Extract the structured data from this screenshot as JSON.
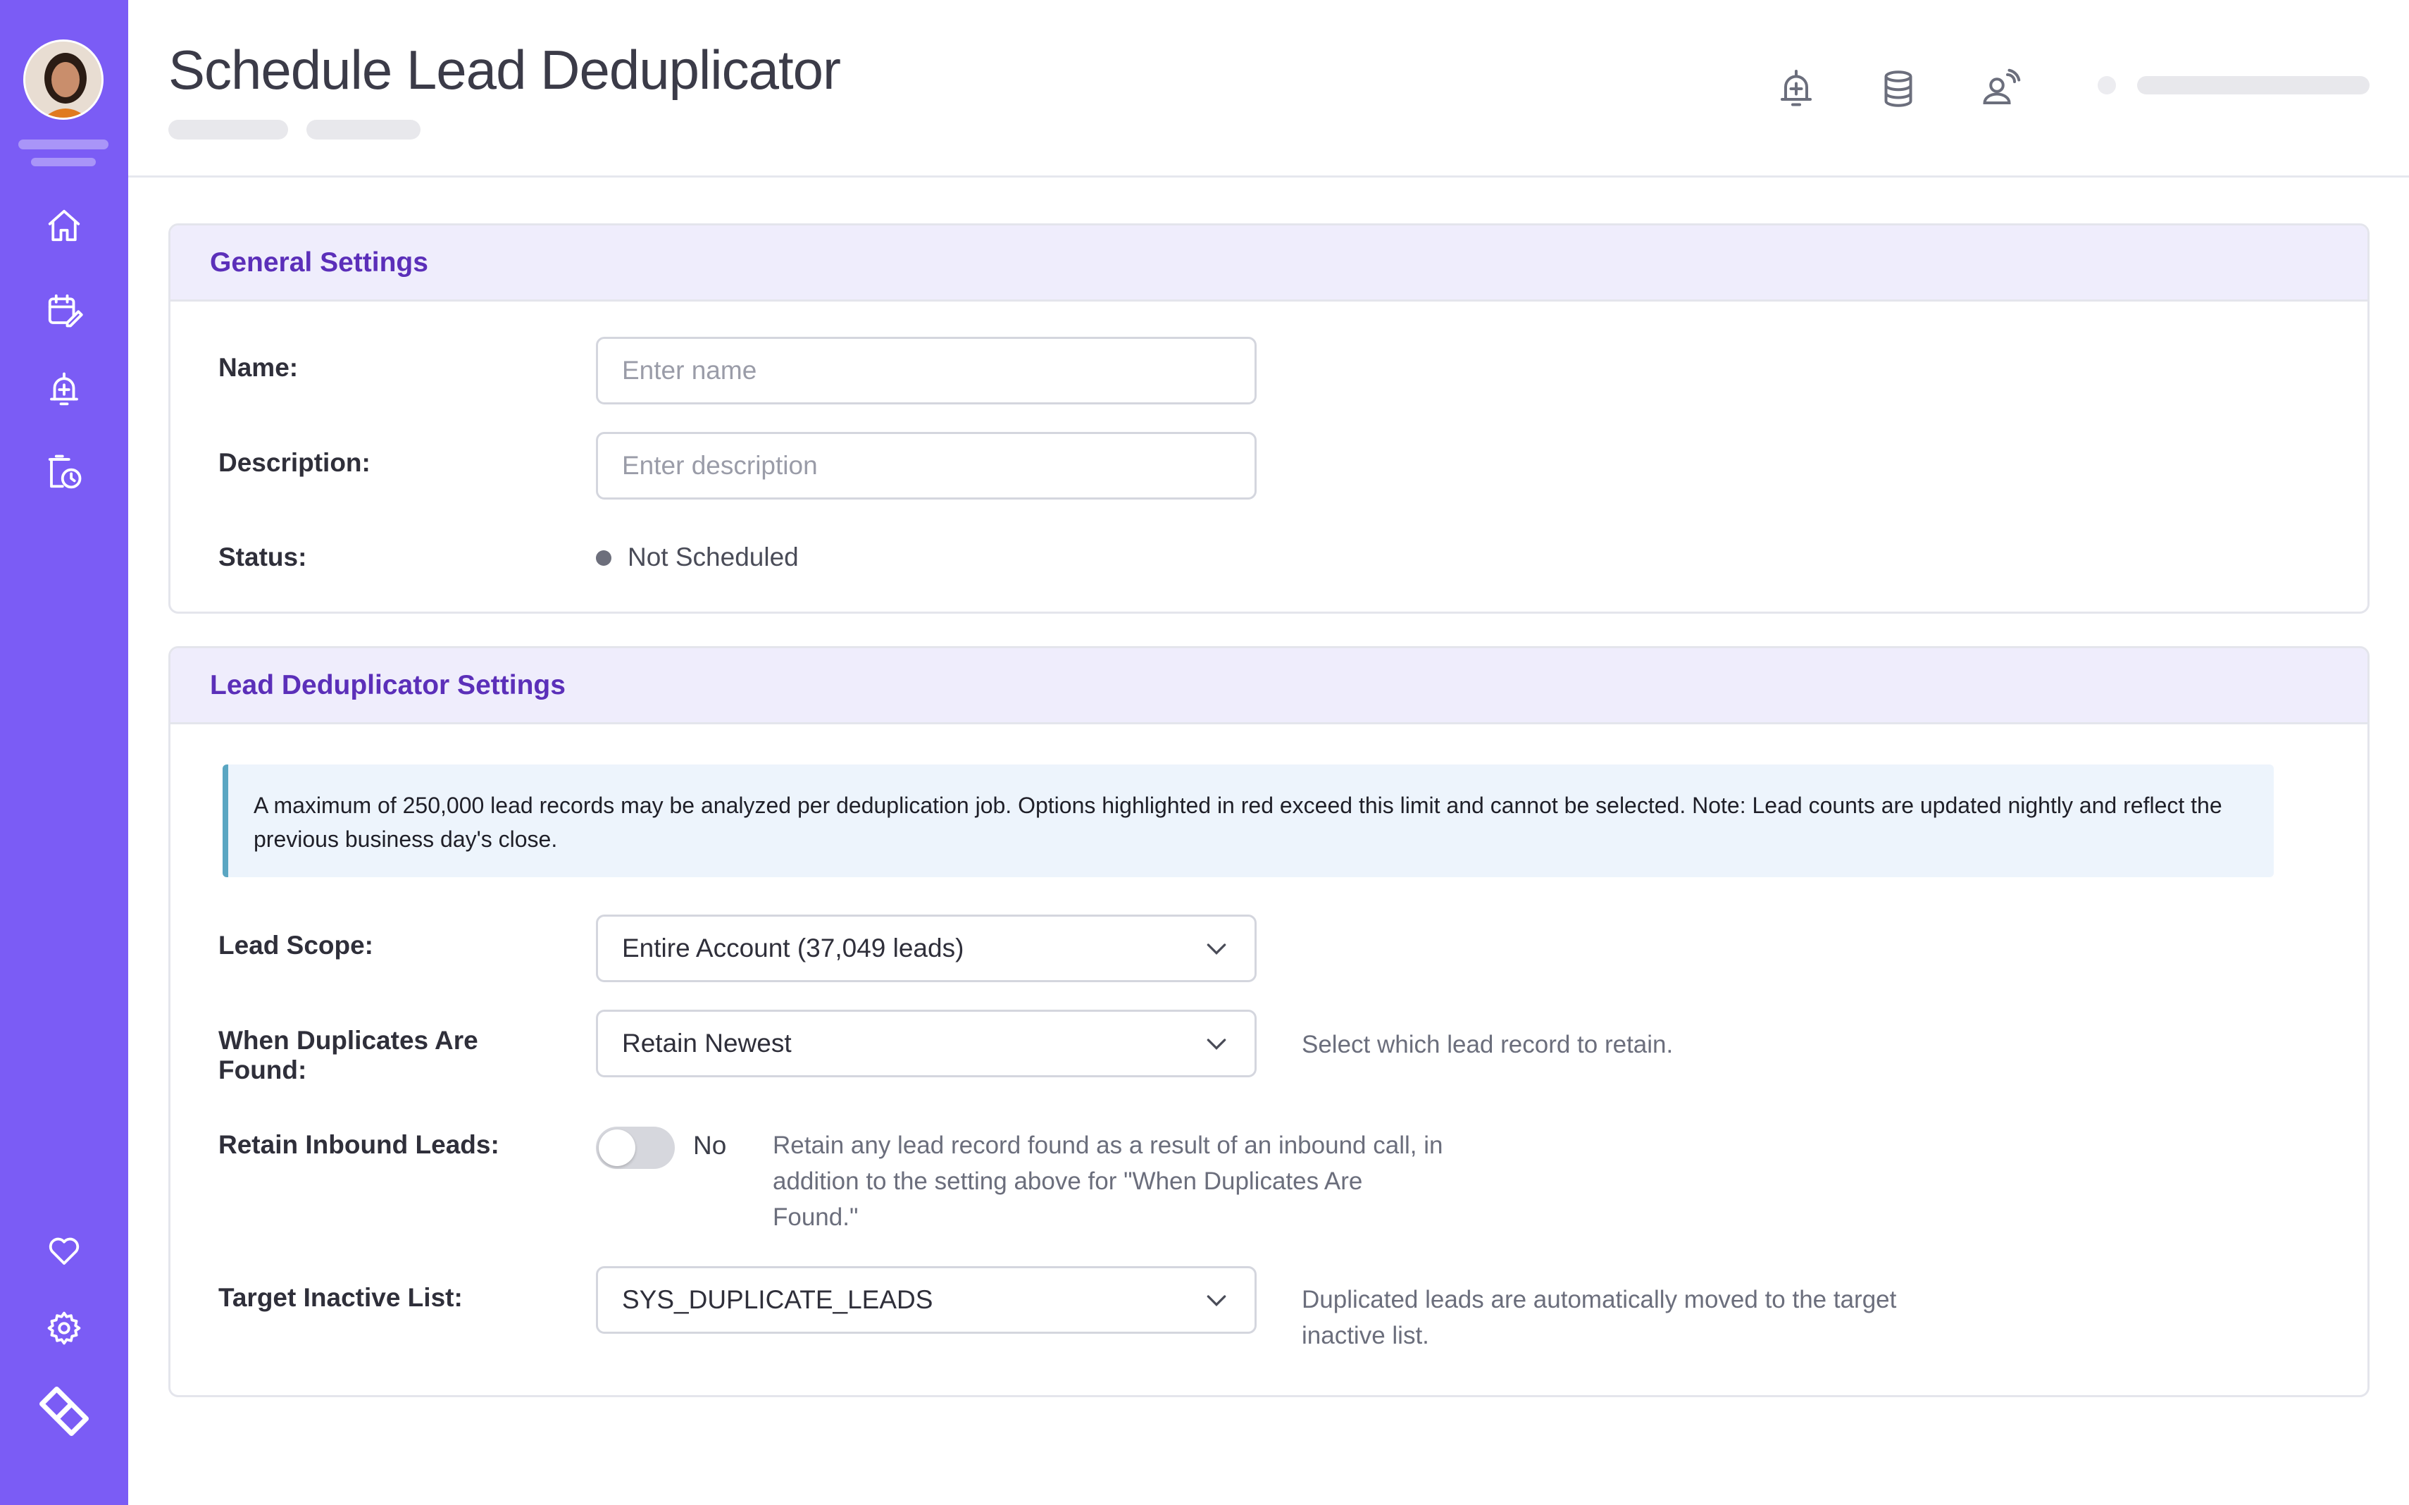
{
  "header": {
    "title": "Schedule Lead Deduplicator"
  },
  "sidebar": {
    "items": [
      {
        "icon": "home-icon"
      },
      {
        "icon": "calendar-edit-icon"
      },
      {
        "icon": "alarm-add-icon"
      },
      {
        "icon": "schedule-history-icon"
      },
      {
        "icon": "heart-icon"
      },
      {
        "icon": "gear-icon"
      },
      {
        "icon": "brand-logo-icon"
      }
    ]
  },
  "header_icons": [
    "alarm-add-icon",
    "database-icon",
    "agent-call-icon"
  ],
  "general_settings": {
    "title": "General Settings",
    "name_label": "Name:",
    "name_placeholder": "Enter name",
    "description_label": "Description:",
    "description_placeholder": "Enter description",
    "status_label": "Status:",
    "status_value": "Not Scheduled"
  },
  "dedup_settings": {
    "title": "Lead Deduplicator Settings",
    "notice_line1": "A maximum of 250,000 lead records may be analyzed per deduplication job. Options highlighted in red exceed this limit and cannot be selected. Note: Lead counts are updated nightly and reflect the",
    "notice_line2": "previous business day's close.",
    "lead_scope_label": "Lead Scope:",
    "lead_scope_value": "Entire Account (37,049 leads)",
    "duplicates_label_line1": "When Duplicates Are",
    "duplicates_label_line2": "Found:",
    "duplicates_value": "Retain Newest",
    "duplicates_help": "Select which lead record to retain.",
    "inbound_label": "Retain Inbound Leads:",
    "inbound_toggle_value": "No",
    "inbound_help_line1": "Retain any lead record found as a result of an inbound call, in",
    "inbound_help_line2": "addition to the setting above for \"When Duplicates Are",
    "inbound_help_line3": "Found.\"",
    "target_list_label": "Target Inactive List:",
    "target_list_value": "SYS_DUPLICATE_LEADS",
    "target_list_help_line1": "Duplicated leads are automatically moved to the target",
    "target_list_help_line2": "inactive list."
  },
  "colors": {
    "sidebar": "#7b5cf5",
    "panel_title": "#5b2fb9",
    "panel_header_bg": "#efedfc",
    "notice_bg": "#edf4fc",
    "notice_border": "#5aa6c2"
  }
}
